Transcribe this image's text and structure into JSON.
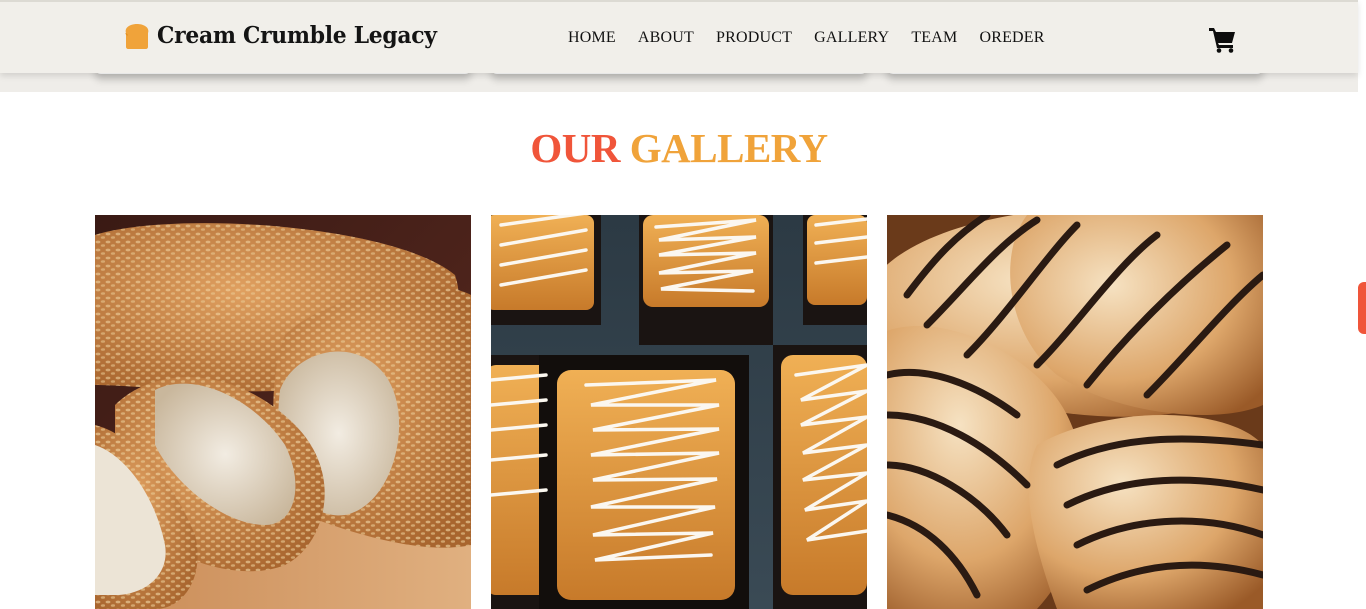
{
  "brand": {
    "name": "Cream Crumble Legacy",
    "icon": "bread-icon",
    "icon_color": "#f0a33a"
  },
  "nav": {
    "items": [
      {
        "label": "HOME"
      },
      {
        "label": "ABOUT"
      },
      {
        "label": "PRODUCT"
      },
      {
        "label": "GALLERY"
      },
      {
        "label": "TEAM"
      },
      {
        "label": "OREDER"
      }
    ],
    "cart_icon": "cart-icon"
  },
  "gallery": {
    "title_word_1": "OUR",
    "title_word_2": "GALLERY",
    "accent_colors": {
      "red": "#f0553a",
      "orange": "#f0a33a"
    },
    "images": [
      {
        "subject": "sesame-bread-loaf"
      },
      {
        "subject": "glazed-loaf-cakes"
      },
      {
        "subject": "chocolate-drizzled-pastries"
      }
    ]
  }
}
